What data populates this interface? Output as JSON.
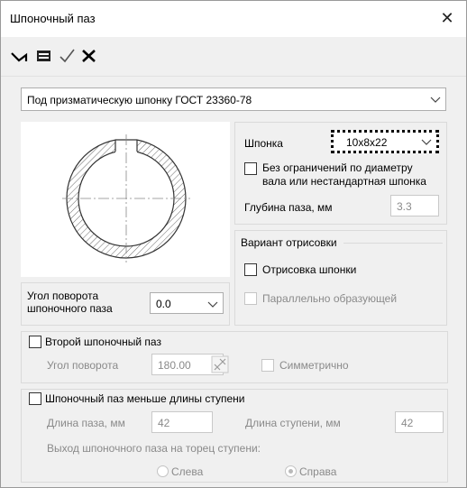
{
  "window": {
    "title": "Шпоночный паз"
  },
  "toolbar": {
    "icons": [
      "create-arrow-icon",
      "save-icon",
      "checkmark-icon",
      "cross-icon"
    ]
  },
  "type_combo": {
    "value": "Под призматическую шпонку ГОСТ 23360-78"
  },
  "key": {
    "label": "Шпонка",
    "value": "10x8x22",
    "unlimited_label_1": "Без ограничений по диаметру",
    "unlimited_label_2": "вала или нестандартная шпонка",
    "depth_label": "Глубина паза, мм",
    "depth_value": "3.3"
  },
  "draw": {
    "group_label": "Вариант отрисовки",
    "draw_key_label": "Отрисовка шпонки",
    "parallel_label": "Параллельно образующей"
  },
  "rotation": {
    "label_1": "Угол поворота",
    "label_2": "шпоночного паза",
    "value": "0.0"
  },
  "second_slot": {
    "label": "Второй шпоночный паз",
    "angle_label": "Угол поворота",
    "angle_value": "180.00",
    "symmetric_label": "Симметрично"
  },
  "short_slot": {
    "label": "Шпоночный паз меньше длины ступени",
    "slot_length_label": "Длина паза, мм",
    "slot_length_value": "42",
    "step_length_label": "Длина ступени, мм",
    "step_length_value": "42",
    "exit_label": "Выход шпоночного паза на торец ступени:",
    "left_label": "Слева",
    "right_label": "Справа"
  },
  "colors": {
    "window_bg": "#f0f0f0",
    "border": "#adadad",
    "disabled_text": "#8a8a8a"
  }
}
